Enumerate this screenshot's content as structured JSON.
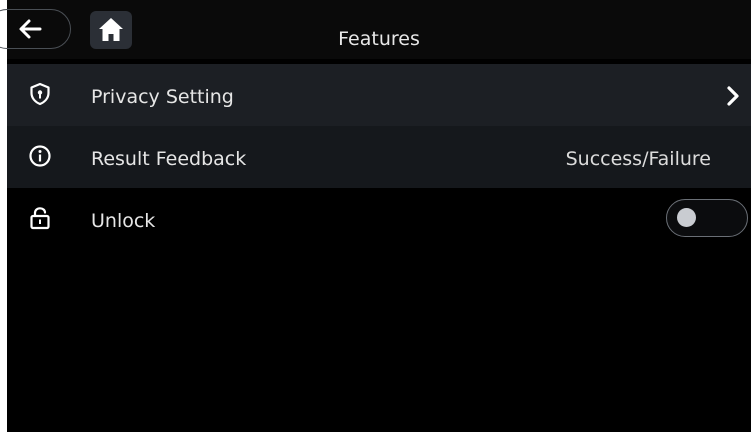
{
  "header": {
    "title": "Features",
    "back_icon": "arrow-left-icon",
    "home_icon": "home-icon"
  },
  "rows": [
    {
      "label": "Privacy Setting",
      "icon": "shield-icon",
      "control": "chevron-right-icon"
    },
    {
      "label": "Result Feedback",
      "icon": "info-icon",
      "value": "Success/Failure"
    },
    {
      "label": "Unlock",
      "icon": "unlock-icon",
      "toggle_on": false
    }
  ],
  "colors": {
    "background": "#000000",
    "row_highlight": "#1c1f24",
    "text": "#e6e6e6",
    "home_button_bg": "#2b2f36"
  }
}
